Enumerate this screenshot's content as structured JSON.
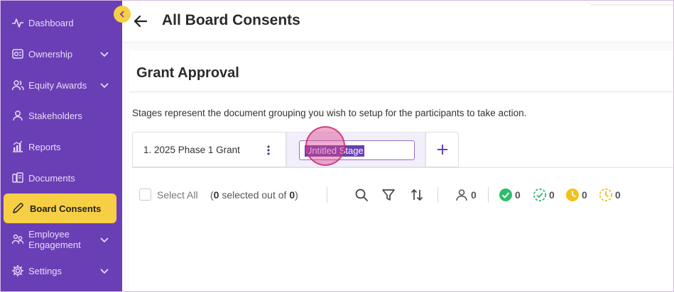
{
  "sidebar": {
    "items": [
      {
        "label": "Dashboard",
        "icon": "activity-icon",
        "has_chevron": false
      },
      {
        "label": "Ownership",
        "icon": "ownership-icon",
        "has_chevron": true
      },
      {
        "label": "Equity Awards",
        "icon": "users-icon",
        "has_chevron": true
      },
      {
        "label": "Stakeholders",
        "icon": "user-icon",
        "has_chevron": false
      },
      {
        "label": "Reports",
        "icon": "bar-chart-icon",
        "has_chevron": false
      },
      {
        "label": "Documents",
        "icon": "documents-icon",
        "has_chevron": false
      },
      {
        "label": "Board Consents",
        "icon": "pencil-icon",
        "has_chevron": false,
        "active": true
      },
      {
        "label_line1": "Employee",
        "label_line2": "Engagement",
        "icon": "engagement-icon",
        "has_chevron": true
      },
      {
        "label": "Settings",
        "icon": "gear-icon",
        "has_chevron": true
      }
    ]
  },
  "header": {
    "title": "All Board Consents"
  },
  "section": {
    "title": "Grant Approval",
    "description": "Stages represent the document grouping you wish to setup for the participants to take action."
  },
  "stages": {
    "tab1_label": "1. 2025 Phase 1 Grant",
    "editing_value": "Untitled Stage"
  },
  "toolbar": {
    "select_all": "Select All",
    "selected_count": "0",
    "selected_mid": " selected out of ",
    "total_count": "0",
    "stats": {
      "participants": "0",
      "completed": "0",
      "partially_completed": "0",
      "pending": "0",
      "partially_pending": "0"
    }
  },
  "colors": {
    "sidebar_bg": "#6a3fb5",
    "accent_yellow": "#f7cf45",
    "green": "#2ebd6b",
    "purple": "#6a3fb5"
  }
}
